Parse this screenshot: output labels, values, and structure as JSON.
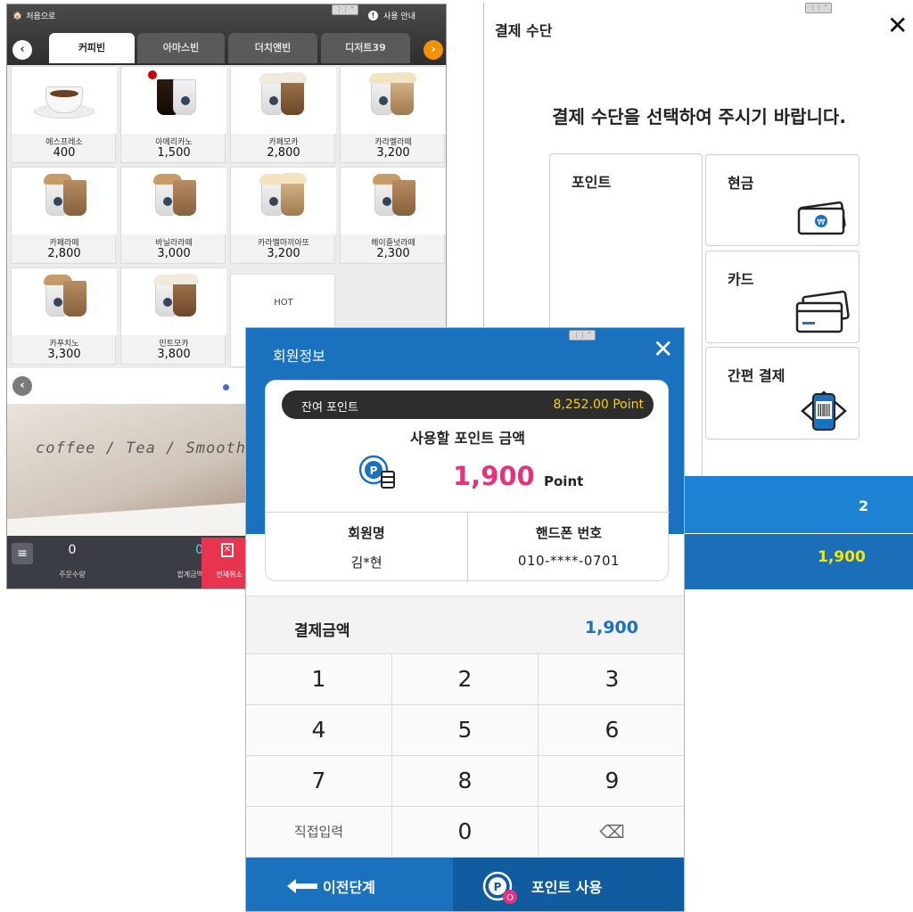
{
  "kiosk": {
    "home_label": "처음으로",
    "guide_label": "사용 안내",
    "tabs": [
      "커피빈",
      "아마스빈",
      "더치앤빈",
      "디저트39"
    ],
    "items": [
      {
        "name": "에스프레소",
        "price": "400",
        "type": "espresso"
      },
      {
        "name": "아메리카노",
        "price": "1,500",
        "type": "americano"
      },
      {
        "name": "카페모카",
        "price": "2,800",
        "type": "mocha"
      },
      {
        "name": "카라멜라떼",
        "price": "3,200",
        "type": "caramel"
      },
      {
        "name": "카페라떼",
        "price": "2,800",
        "type": "latte"
      },
      {
        "name": "바닐라라떼",
        "price": "3,000",
        "type": "latte"
      },
      {
        "name": "카라멜마끼아또",
        "price": "3,200",
        "type": "caramel"
      },
      {
        "name": "헤이즐넛라떼",
        "price": "2,300",
        "type": "latte"
      },
      {
        "name": "카푸치노",
        "price": "3,300",
        "type": "latte"
      },
      {
        "name": "민트모카",
        "price": "3,800",
        "type": "mocha"
      }
    ],
    "hot_label": "HOT",
    "banner_text": "coffee / Tea / Smooth",
    "order_count": "0",
    "order_count_label": "주문수량",
    "total_amount": "0",
    "total_amount_label": "합계금액",
    "cancel_all_label": "전체취소"
  },
  "payment": {
    "title": "결제 수단",
    "instruction": "결제 수단을 선택하여 주시기 바랍니다.",
    "methods": {
      "point": "포인트",
      "cash": "현금",
      "card": "카드",
      "simple": "간편 결제"
    },
    "bar_count": "2",
    "bar_amount": "1,900"
  },
  "member": {
    "title": "회원정보",
    "balance_label": "잔여 포인트",
    "balance_value": "8,252.00 Point",
    "use_title": "사용할 포인트 금액",
    "amount": "1,900",
    "amount_unit": "Point",
    "name_label": "회원명",
    "name_value": "김*현",
    "phone_label": "핸드폰 번호",
    "phone_value": "010-****-0701",
    "pay_label": "결제금액",
    "pay_value": "1,900",
    "keys": [
      "1",
      "2",
      "3",
      "4",
      "5",
      "6",
      "7",
      "8",
      "9",
      "직접입력",
      "0",
      "⌫"
    ],
    "prev_label": "이전단계",
    "use_label": "포인트 사용"
  },
  "colors": {
    "primary_blue": "#1a72bf",
    "accent_pink": "#e8307c",
    "accent_orange": "#f39200",
    "balance_yellow": "#f4d20a",
    "cancel_red": "#e8344e"
  }
}
